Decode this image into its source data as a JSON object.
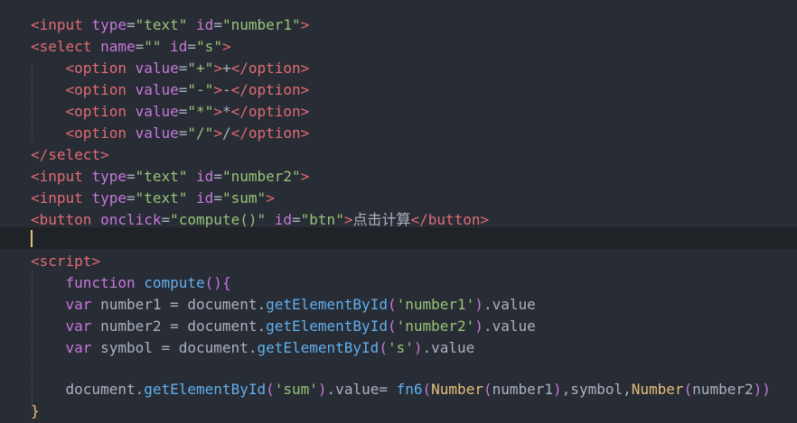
{
  "editor": {
    "lines": [
      {
        "segments": [
          [
            "tag",
            "<input "
          ],
          [
            "attr",
            "type"
          ],
          [
            "punc",
            "="
          ],
          [
            "str",
            "\"text\""
          ],
          [
            "punc",
            " "
          ],
          [
            "attr",
            "id"
          ],
          [
            "punc",
            "="
          ],
          [
            "str",
            "\"number1\""
          ],
          [
            "tag",
            ">"
          ]
        ]
      },
      {
        "segments": [
          [
            "tag",
            "<select "
          ],
          [
            "attr",
            "name"
          ],
          [
            "punc",
            "="
          ],
          [
            "str",
            "\"\""
          ],
          [
            "punc",
            " "
          ],
          [
            "attr",
            "id"
          ],
          [
            "punc",
            "="
          ],
          [
            "str",
            "\"s\""
          ],
          [
            "tag",
            ">"
          ]
        ]
      },
      {
        "segments": [
          [
            "punc",
            "    "
          ],
          [
            "tag",
            "<option "
          ],
          [
            "attr",
            "value"
          ],
          [
            "punc",
            "="
          ],
          [
            "str",
            "\"+\""
          ],
          [
            "tag",
            ">"
          ],
          [
            "punc",
            "+"
          ],
          [
            "tag",
            "</option>"
          ]
        ]
      },
      {
        "segments": [
          [
            "punc",
            "    "
          ],
          [
            "tag",
            "<option "
          ],
          [
            "attr",
            "value"
          ],
          [
            "punc",
            "="
          ],
          [
            "str",
            "\"-\""
          ],
          [
            "tag",
            ">"
          ],
          [
            "punc",
            "-"
          ],
          [
            "tag",
            "</option>"
          ]
        ]
      },
      {
        "segments": [
          [
            "punc",
            "    "
          ],
          [
            "tag",
            "<option "
          ],
          [
            "attr",
            "value"
          ],
          [
            "punc",
            "="
          ],
          [
            "str",
            "\"*\""
          ],
          [
            "tag",
            ">"
          ],
          [
            "punc",
            "*"
          ],
          [
            "tag",
            "</option>"
          ]
        ]
      },
      {
        "segments": [
          [
            "punc",
            "    "
          ],
          [
            "tag",
            "<option "
          ],
          [
            "attr",
            "value"
          ],
          [
            "punc",
            "="
          ],
          [
            "str",
            "\"/\""
          ],
          [
            "tag",
            ">"
          ],
          [
            "punc",
            "/"
          ],
          [
            "tag",
            "</option>"
          ]
        ]
      },
      {
        "segments": [
          [
            "tag",
            "</select>"
          ]
        ]
      },
      {
        "segments": [
          [
            "tag",
            "<input "
          ],
          [
            "attr",
            "type"
          ],
          [
            "punc",
            "="
          ],
          [
            "str",
            "\"text\""
          ],
          [
            "punc",
            " "
          ],
          [
            "attr",
            "id"
          ],
          [
            "punc",
            "="
          ],
          [
            "str",
            "\"number2\""
          ],
          [
            "tag",
            ">"
          ]
        ]
      },
      {
        "segments": [
          [
            "tag",
            "<input "
          ],
          [
            "attr",
            "type"
          ],
          [
            "punc",
            "="
          ],
          [
            "str",
            "\"text\""
          ],
          [
            "punc",
            " "
          ],
          [
            "attr",
            "id"
          ],
          [
            "punc",
            "="
          ],
          [
            "str",
            "\"sum\""
          ],
          [
            "tag",
            ">"
          ]
        ]
      },
      {
        "segments": [
          [
            "tag",
            "<button "
          ],
          [
            "attr",
            "onclick"
          ],
          [
            "punc",
            "="
          ],
          [
            "str",
            "\"compute()\""
          ],
          [
            "punc",
            " "
          ],
          [
            "attr",
            "id"
          ],
          [
            "punc",
            "="
          ],
          [
            "str",
            "\"btn\""
          ],
          [
            "tag",
            ">"
          ],
          [
            "punc",
            "点击计算"
          ],
          [
            "tag",
            "</button>"
          ]
        ]
      },
      {
        "segments": [],
        "active": true
      },
      {
        "segments": [
          [
            "tag",
            "<script>"
          ]
        ]
      },
      {
        "segments": [
          [
            "punc",
            "    "
          ],
          [
            "kw",
            "function "
          ],
          [
            "fn",
            "compute"
          ],
          [
            "paren",
            "(){"
          ]
        ]
      },
      {
        "segments": [
          [
            "punc",
            "    "
          ],
          [
            "kw",
            "var "
          ],
          [
            "prop",
            "number1 = document."
          ],
          [
            "fn",
            "getElementById"
          ],
          [
            "paren",
            "("
          ],
          [
            "str",
            "'number1'"
          ],
          [
            "paren",
            ")"
          ],
          [
            "prop",
            ".value"
          ]
        ]
      },
      {
        "segments": [
          [
            "punc",
            "    "
          ],
          [
            "kw",
            "var "
          ],
          [
            "prop",
            "number2 = document."
          ],
          [
            "fn",
            "getElementById"
          ],
          [
            "paren",
            "("
          ],
          [
            "str",
            "'number2'"
          ],
          [
            "paren",
            ")"
          ],
          [
            "prop",
            ".value"
          ]
        ]
      },
      {
        "segments": [
          [
            "punc",
            "    "
          ],
          [
            "kw",
            "var "
          ],
          [
            "prop",
            "symbol = document."
          ],
          [
            "fn",
            "getElementById"
          ],
          [
            "paren",
            "("
          ],
          [
            "str",
            "'s'"
          ],
          [
            "paren",
            ")"
          ],
          [
            "prop",
            ".value"
          ]
        ]
      },
      {
        "segments": []
      },
      {
        "segments": [
          [
            "punc",
            "    "
          ],
          [
            "prop",
            "document."
          ],
          [
            "fn",
            "getElementById"
          ],
          [
            "paren",
            "("
          ],
          [
            "str",
            "'sum'"
          ],
          [
            "paren",
            ")"
          ],
          [
            "prop",
            ".value= "
          ],
          [
            "fn",
            "fn6"
          ],
          [
            "paren",
            "("
          ],
          [
            "type",
            "Number"
          ],
          [
            "paren",
            "("
          ],
          [
            "prop",
            "number1"
          ],
          [
            "paren",
            ")"
          ],
          [
            "prop",
            ",symbol,"
          ],
          [
            "type",
            "Number"
          ],
          [
            "paren",
            "("
          ],
          [
            "prop",
            "number2"
          ],
          [
            "paren",
            "))"
          ]
        ]
      },
      {
        "segments": [
          [
            "type",
            "}"
          ]
        ]
      }
    ]
  }
}
